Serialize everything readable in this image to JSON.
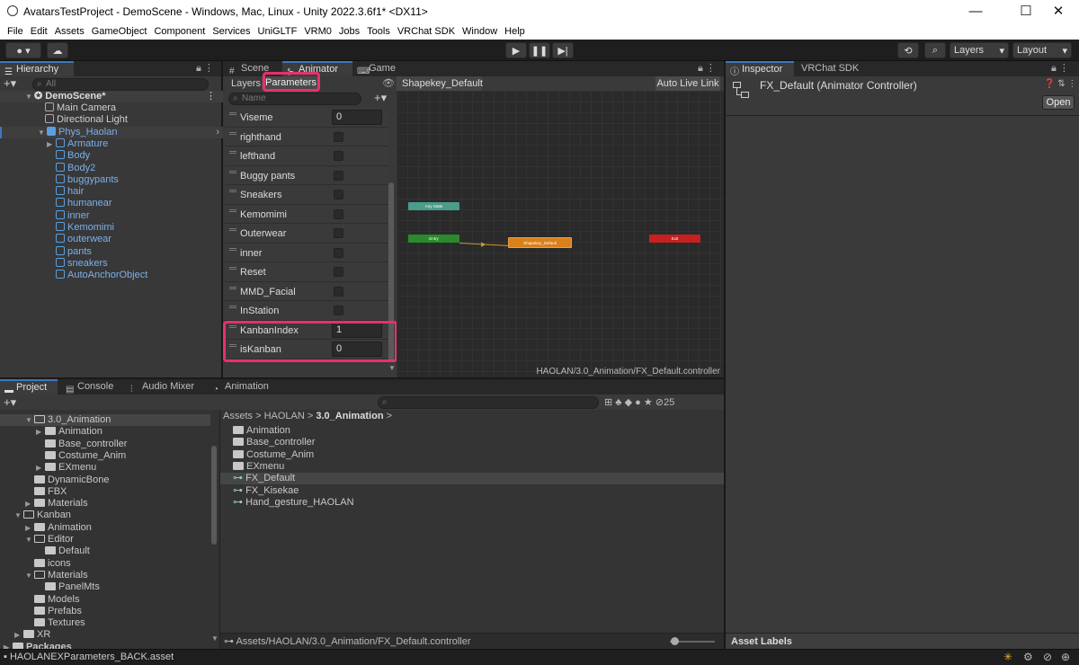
{
  "window": {
    "title": "AvatarsTestProject - DemoScene - Windows, Mac, Linux - Unity 2022.3.6f1* <DX11>",
    "minimize": "—",
    "maximize": "☐",
    "close": "✕"
  },
  "menu": [
    "File",
    "Edit",
    "Assets",
    "GameObject",
    "Component",
    "Services",
    "UniGLTF",
    "VRM0",
    "Jobs",
    "Tools",
    "VRChat SDK",
    "Window",
    "Help"
  ],
  "toolbar": {
    "layers_label": "Layers",
    "layout_label": "Layout"
  },
  "hierarchy": {
    "tab": "Hierarchy",
    "search_placeholder": "All",
    "scene": "DemoScene*",
    "items": [
      {
        "label": "Main Camera",
        "indent": 1,
        "prefab": false,
        "expand": ""
      },
      {
        "label": "Directional Light",
        "indent": 1,
        "prefab": false,
        "expand": ""
      },
      {
        "label": "Phys_Haolan",
        "indent": 1,
        "prefab": true,
        "expand": "▼",
        "selected": true
      },
      {
        "label": "Armature",
        "indent": 2,
        "prefab": true,
        "expand": "▶"
      },
      {
        "label": "Body",
        "indent": 2,
        "prefab": true,
        "expand": ""
      },
      {
        "label": "Body2",
        "indent": 2,
        "prefab": true,
        "expand": ""
      },
      {
        "label": "buggypants",
        "indent": 2,
        "prefab": true,
        "expand": ""
      },
      {
        "label": "hair",
        "indent": 2,
        "prefab": true,
        "expand": ""
      },
      {
        "label": "humanear",
        "indent": 2,
        "prefab": true,
        "expand": ""
      },
      {
        "label": "inner",
        "indent": 2,
        "prefab": true,
        "expand": ""
      },
      {
        "label": "Kemomimi",
        "indent": 2,
        "prefab": true,
        "expand": ""
      },
      {
        "label": "outerwear",
        "indent": 2,
        "prefab": true,
        "expand": ""
      },
      {
        "label": "pants",
        "indent": 2,
        "prefab": true,
        "expand": ""
      },
      {
        "label": "sneakers",
        "indent": 2,
        "prefab": true,
        "expand": ""
      },
      {
        "label": "AutoAnchorObject",
        "indent": 2,
        "prefab": true,
        "expand": ""
      }
    ]
  },
  "center_tabs": {
    "scene": "Scene",
    "animator": "Animator",
    "game": "Game"
  },
  "animator": {
    "layers_tab": "Layers",
    "parameters_tab": "Parameters",
    "search_placeholder": "Name",
    "breadcrumb": "Shapekey_Default",
    "auto_live_link": "Auto Live Link",
    "footer_path": "HAOLAN/3.0_Animation/FX_Default.controller",
    "parameters": [
      {
        "name": "Viseme",
        "type": "int",
        "value": "0"
      },
      {
        "name": "righthand",
        "type": "bool"
      },
      {
        "name": "lefthand",
        "type": "bool"
      },
      {
        "name": "Buggy pants",
        "type": "bool"
      },
      {
        "name": "Sneakers",
        "type": "bool"
      },
      {
        "name": "Kemomimi",
        "type": "bool"
      },
      {
        "name": "Outerwear",
        "type": "bool"
      },
      {
        "name": "inner",
        "type": "bool"
      },
      {
        "name": "Reset",
        "type": "bool"
      },
      {
        "name": "MMD_Facial",
        "type": "bool"
      },
      {
        "name": "InStation",
        "type": "bool"
      },
      {
        "name": "KanbanIndex",
        "type": "int",
        "value": "1"
      },
      {
        "name": "isKanban",
        "type": "int",
        "value": "0"
      }
    ],
    "nodes": {
      "any_state": "Any State",
      "entry": "Entry",
      "default_state": "Shapekey_Default",
      "exit": "Exit"
    }
  },
  "inspector": {
    "tab": "Inspector",
    "sdk_tab": "VRChat SDK",
    "title": "FX_Default (Animator Controller)",
    "open_button": "Open",
    "asset_labels": "Asset Labels"
  },
  "bottom_tabs": {
    "project": "Project",
    "console": "Console",
    "audio_mixer": "Audio Mixer",
    "animation": "Animation"
  },
  "project": {
    "hidden_count": "25",
    "breadcrumb": {
      "assets": "Assets",
      "haolan": "HAOLAN",
      "current": "3.0_Animation"
    },
    "tree": [
      {
        "label": "3.0_Animation",
        "indent": 1,
        "expand": "▼",
        "open": true,
        "selected": true
      },
      {
        "label": "Animation",
        "indent": 2,
        "expand": "▶"
      },
      {
        "label": "Base_controller",
        "indent": 2,
        "expand": ""
      },
      {
        "label": "Costume_Anim",
        "indent": 2,
        "expand": ""
      },
      {
        "label": "EXmenu",
        "indent": 2,
        "expand": "▶"
      },
      {
        "label": "DynamicBone",
        "indent": 1,
        "expand": ""
      },
      {
        "label": "FBX",
        "indent": 1,
        "expand": ""
      },
      {
        "label": "Materials",
        "indent": 1,
        "expand": "▶"
      },
      {
        "label": "Kanban",
        "indent": 0,
        "expand": "▼",
        "open": true
      },
      {
        "label": "Animation",
        "indent": 1,
        "expand": "▶"
      },
      {
        "label": "Editor",
        "indent": 1,
        "expand": "▼",
        "open": true
      },
      {
        "label": "Default",
        "indent": 2,
        "expand": ""
      },
      {
        "label": "icons",
        "indent": 1,
        "expand": ""
      },
      {
        "label": "Materials",
        "indent": 1,
        "expand": "▼",
        "open": true
      },
      {
        "label": "PanelMts",
        "indent": 2,
        "expand": ""
      },
      {
        "label": "Models",
        "indent": 1,
        "expand": ""
      },
      {
        "label": "Prefabs",
        "indent": 1,
        "expand": ""
      },
      {
        "label": "Textures",
        "indent": 1,
        "expand": ""
      },
      {
        "label": "XR",
        "indent": 0,
        "expand": "▶"
      },
      {
        "label": "Packages",
        "indent": -1,
        "expand": "▶",
        "bold": true
      }
    ],
    "files": [
      {
        "label": "Animation",
        "kind": "folder"
      },
      {
        "label": "Base_controller",
        "kind": "folder"
      },
      {
        "label": "Costume_Anim",
        "kind": "folder"
      },
      {
        "label": "EXmenu",
        "kind": "folder"
      },
      {
        "label": "FX_Default",
        "kind": "controller",
        "selected": true
      },
      {
        "label": "FX_Kisekae",
        "kind": "controller"
      },
      {
        "label": "Hand_gesture_HAOLAN",
        "kind": "controller"
      }
    ],
    "footer_path": "Assets/HAOLAN/3.0_Animation/FX_Default.controller"
  },
  "status_bar": {
    "message": "HAOLANEXParameters_BACK.asset"
  }
}
